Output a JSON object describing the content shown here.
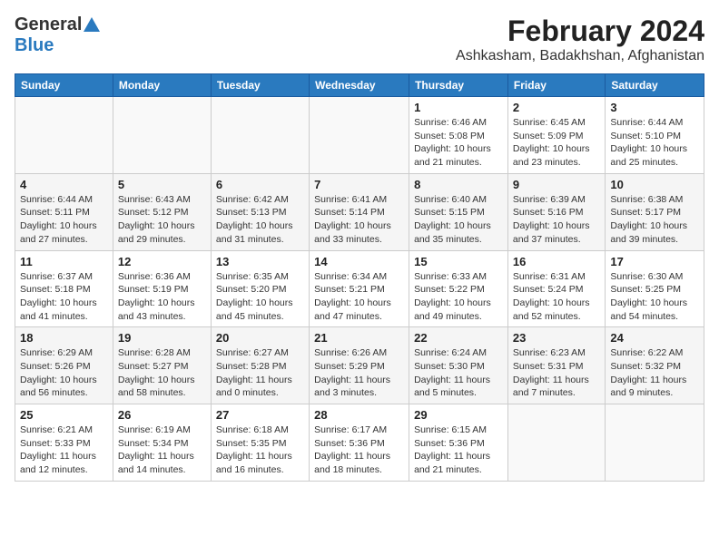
{
  "header": {
    "logo_general": "General",
    "logo_blue": "Blue",
    "title": "February 2024",
    "subtitle": "Ashkasham, Badakhshan, Afghanistan"
  },
  "weekdays": [
    "Sunday",
    "Monday",
    "Tuesday",
    "Wednesday",
    "Thursday",
    "Friday",
    "Saturday"
  ],
  "weeks": [
    [
      {
        "day": "",
        "info": ""
      },
      {
        "day": "",
        "info": ""
      },
      {
        "day": "",
        "info": ""
      },
      {
        "day": "",
        "info": ""
      },
      {
        "day": "1",
        "info": "Sunrise: 6:46 AM\nSunset: 5:08 PM\nDaylight: 10 hours and 21 minutes."
      },
      {
        "day": "2",
        "info": "Sunrise: 6:45 AM\nSunset: 5:09 PM\nDaylight: 10 hours and 23 minutes."
      },
      {
        "day": "3",
        "info": "Sunrise: 6:44 AM\nSunset: 5:10 PM\nDaylight: 10 hours and 25 minutes."
      }
    ],
    [
      {
        "day": "4",
        "info": "Sunrise: 6:44 AM\nSunset: 5:11 PM\nDaylight: 10 hours and 27 minutes."
      },
      {
        "day": "5",
        "info": "Sunrise: 6:43 AM\nSunset: 5:12 PM\nDaylight: 10 hours and 29 minutes."
      },
      {
        "day": "6",
        "info": "Sunrise: 6:42 AM\nSunset: 5:13 PM\nDaylight: 10 hours and 31 minutes."
      },
      {
        "day": "7",
        "info": "Sunrise: 6:41 AM\nSunset: 5:14 PM\nDaylight: 10 hours and 33 minutes."
      },
      {
        "day": "8",
        "info": "Sunrise: 6:40 AM\nSunset: 5:15 PM\nDaylight: 10 hours and 35 minutes."
      },
      {
        "day": "9",
        "info": "Sunrise: 6:39 AM\nSunset: 5:16 PM\nDaylight: 10 hours and 37 minutes."
      },
      {
        "day": "10",
        "info": "Sunrise: 6:38 AM\nSunset: 5:17 PM\nDaylight: 10 hours and 39 minutes."
      }
    ],
    [
      {
        "day": "11",
        "info": "Sunrise: 6:37 AM\nSunset: 5:18 PM\nDaylight: 10 hours and 41 minutes."
      },
      {
        "day": "12",
        "info": "Sunrise: 6:36 AM\nSunset: 5:19 PM\nDaylight: 10 hours and 43 minutes."
      },
      {
        "day": "13",
        "info": "Sunrise: 6:35 AM\nSunset: 5:20 PM\nDaylight: 10 hours and 45 minutes."
      },
      {
        "day": "14",
        "info": "Sunrise: 6:34 AM\nSunset: 5:21 PM\nDaylight: 10 hours and 47 minutes."
      },
      {
        "day": "15",
        "info": "Sunrise: 6:33 AM\nSunset: 5:22 PM\nDaylight: 10 hours and 49 minutes."
      },
      {
        "day": "16",
        "info": "Sunrise: 6:31 AM\nSunset: 5:24 PM\nDaylight: 10 hours and 52 minutes."
      },
      {
        "day": "17",
        "info": "Sunrise: 6:30 AM\nSunset: 5:25 PM\nDaylight: 10 hours and 54 minutes."
      }
    ],
    [
      {
        "day": "18",
        "info": "Sunrise: 6:29 AM\nSunset: 5:26 PM\nDaylight: 10 hours and 56 minutes."
      },
      {
        "day": "19",
        "info": "Sunrise: 6:28 AM\nSunset: 5:27 PM\nDaylight: 10 hours and 58 minutes."
      },
      {
        "day": "20",
        "info": "Sunrise: 6:27 AM\nSunset: 5:28 PM\nDaylight: 11 hours and 0 minutes."
      },
      {
        "day": "21",
        "info": "Sunrise: 6:26 AM\nSunset: 5:29 PM\nDaylight: 11 hours and 3 minutes."
      },
      {
        "day": "22",
        "info": "Sunrise: 6:24 AM\nSunset: 5:30 PM\nDaylight: 11 hours and 5 minutes."
      },
      {
        "day": "23",
        "info": "Sunrise: 6:23 AM\nSunset: 5:31 PM\nDaylight: 11 hours and 7 minutes."
      },
      {
        "day": "24",
        "info": "Sunrise: 6:22 AM\nSunset: 5:32 PM\nDaylight: 11 hours and 9 minutes."
      }
    ],
    [
      {
        "day": "25",
        "info": "Sunrise: 6:21 AM\nSunset: 5:33 PM\nDaylight: 11 hours and 12 minutes."
      },
      {
        "day": "26",
        "info": "Sunrise: 6:19 AM\nSunset: 5:34 PM\nDaylight: 11 hours and 14 minutes."
      },
      {
        "day": "27",
        "info": "Sunrise: 6:18 AM\nSunset: 5:35 PM\nDaylight: 11 hours and 16 minutes."
      },
      {
        "day": "28",
        "info": "Sunrise: 6:17 AM\nSunset: 5:36 PM\nDaylight: 11 hours and 18 minutes."
      },
      {
        "day": "29",
        "info": "Sunrise: 6:15 AM\nSunset: 5:36 PM\nDaylight: 11 hours and 21 minutes."
      },
      {
        "day": "",
        "info": ""
      },
      {
        "day": "",
        "info": ""
      }
    ]
  ]
}
